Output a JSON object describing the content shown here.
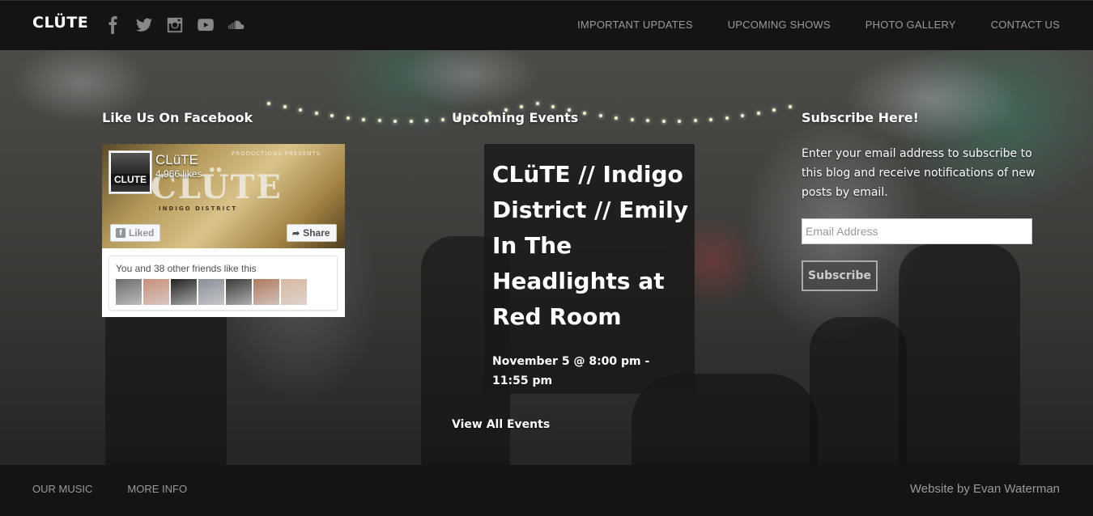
{
  "header": {
    "logo": "CLÜTE",
    "social": [
      "facebook-icon",
      "twitter-icon",
      "instagram-icon",
      "youtube-icon",
      "soundcloud-icon"
    ],
    "nav": [
      "IMPORTANT UPDATES",
      "UPCOMING SHOWS",
      "PHOTO GALLERY",
      "CONTACT US"
    ]
  },
  "facebook": {
    "title": "Like Us On Facebook",
    "thumb_label": "CLUTE",
    "page_name": "CLüTE",
    "likes": "4,966 likes",
    "cover_text": "CLÜTE",
    "cover_subtext": "INDIGO DISTRICT",
    "cover_top": "PRODUCTIONS PRESENTS",
    "liked_label": "Liked",
    "share_label": "Share",
    "friends_text": "You and 38 other friends like this",
    "face_colors": [
      "#6b6b6b",
      "#c98f7a",
      "#222222",
      "#8a8f96",
      "#3a3a3a",
      "#b07a60",
      "#d9b8a0"
    ]
  },
  "events": {
    "title": "Upcoming Events",
    "event_title": "CLüTE // Indigo District // Emily In The Headlights at Red Room",
    "event_date": "November 5 @ 8:00 pm - 11:55 pm",
    "view_all": "View All Events"
  },
  "subscribe": {
    "title": "Subscribe Here!",
    "description": "Enter your email address to subscribe to this blog and receive notifications of new posts by email.",
    "placeholder": "Email Address",
    "button": "Subscribe"
  },
  "footer": {
    "nav": [
      "OUR MUSIC",
      "MORE INFO"
    ],
    "credit": "Website by Evan Waterman"
  }
}
